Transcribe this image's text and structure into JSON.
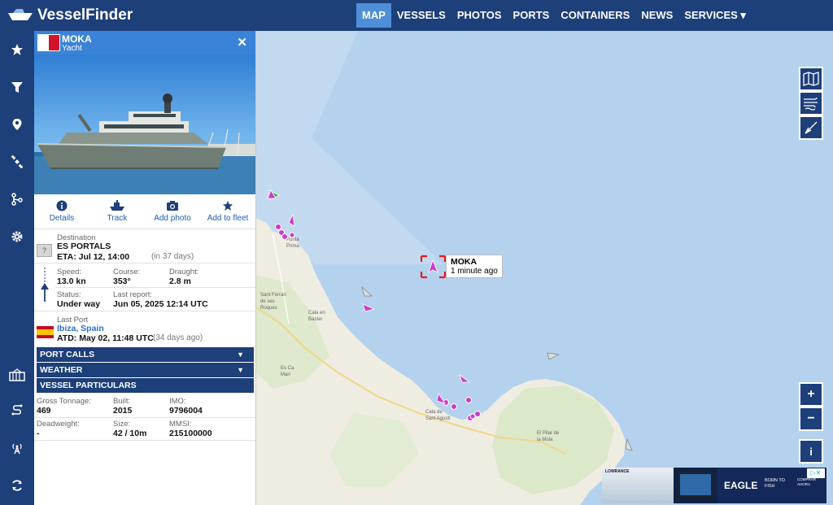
{
  "app": {
    "logo": "VesselFinder"
  },
  "nav": [
    {
      "label": "MAP",
      "active": true
    },
    {
      "label": "VESSELS"
    },
    {
      "label": "PHOTOS"
    },
    {
      "label": "PORTS"
    },
    {
      "label": "CONTAINERS"
    },
    {
      "label": "NEWS"
    },
    {
      "label": "SERVICES ▾"
    }
  ],
  "vessel": {
    "name": "MOKA",
    "type": "Yacht",
    "flag": "Malta",
    "actions": [
      "Details",
      "Track",
      "Add photo",
      "Add to fleet"
    ],
    "destination_label": "Destination",
    "destination": "ES PORTALS",
    "eta": "ETA: Jul 12, 14:00",
    "eta_note": "(in 37 days)",
    "speed_label": "Speed:",
    "speed": "13.0 kn",
    "course_label": "Course:",
    "course": "353°",
    "draught_label": "Draught:",
    "draught": "2.8 m",
    "status_label": "Status:",
    "status": "Under way",
    "last_report_label": "Last report:",
    "last_report": "Jun 05, 2025 12:14 UTC",
    "last_port_label": "Last Port",
    "last_port": "Ibiza, Spain",
    "atd": "ATD: May 02, 11:48 UTC",
    "atd_note": "(34 days ago)",
    "unknown_badge": "?"
  },
  "sections": [
    "PORT CALLS",
    "WEATHER",
    "VESSEL PARTICULARS"
  ],
  "particulars": {
    "gt_label": "Gross Tonnage:",
    "gt": "469",
    "built_label": "Built:",
    "built": "2015",
    "imo_label": "IMO:",
    "imo": "9796004",
    "dwt_label": "Deadweight:",
    "dwt": "-",
    "size_label": "Size:",
    "size": "42 / 10m",
    "mmsi_label": "MMSI:",
    "mmsi": "215100000"
  },
  "map": {
    "tooltip_name": "MOKA",
    "tooltip_time": "1 minute ago",
    "place_labels": [
      "Punta Prima",
      "Sant Ferran de ses Roques",
      "Cala en Baster",
      "Es Ca Marí",
      "Cala de Sant Agustí",
      "El Pilar de la Mola"
    ],
    "zoom_in": "+",
    "zoom_out": "−",
    "info": "i"
  },
  "ad": {
    "brand": "LOWRANCE",
    "product": "EAGLE",
    "tagline": "BORN TO FISH",
    "cta": "COMPRAR AHORA"
  },
  "colors": {
    "navy": "#1d3f7a",
    "accent": "#3a83d8",
    "vessel_pink": "#cc3ccc",
    "sea": "#b4d2ee",
    "land": "#f0efe6"
  }
}
